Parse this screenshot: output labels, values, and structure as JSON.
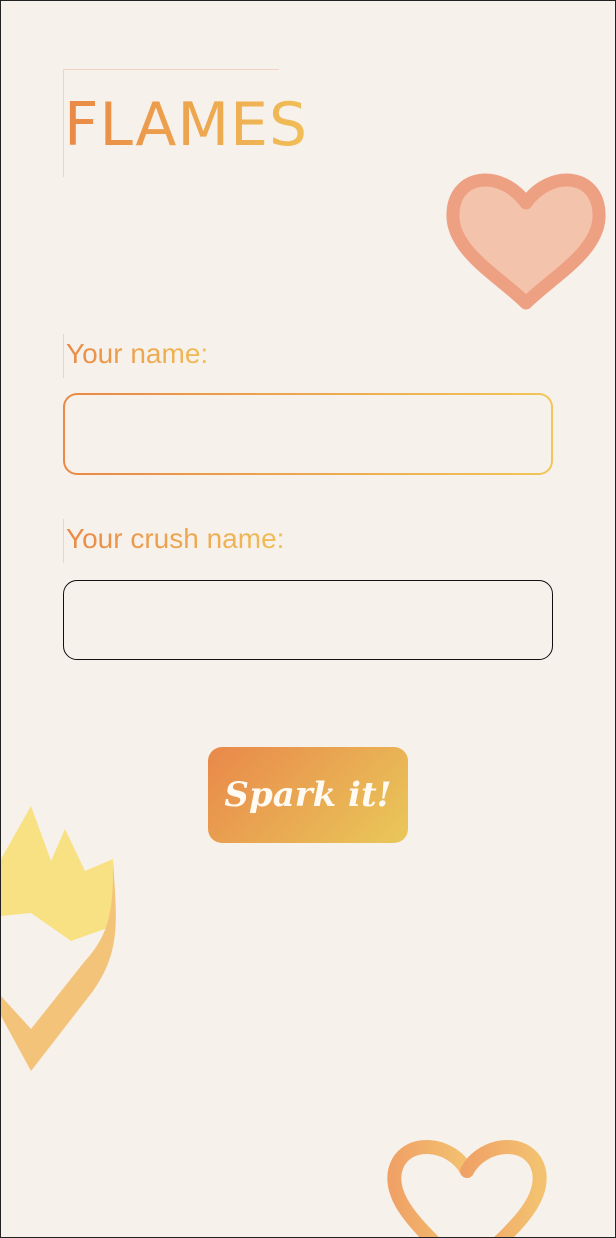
{
  "app": {
    "title": "FLAMES"
  },
  "form": {
    "name_label": "Your name:",
    "name_value": "",
    "crush_label": "Your crush name:",
    "crush_value": "",
    "submit_label": "Spark it!"
  },
  "colors": {
    "background": "#f7f1eb",
    "gradient_start": "#e98945",
    "gradient_end": "#f0bf58",
    "heart_fill": "#f4c3ab",
    "heart_stroke": "#eea083"
  },
  "icons": [
    "heart-icon",
    "flaming-heart-icon",
    "heart-outline-icon"
  ]
}
